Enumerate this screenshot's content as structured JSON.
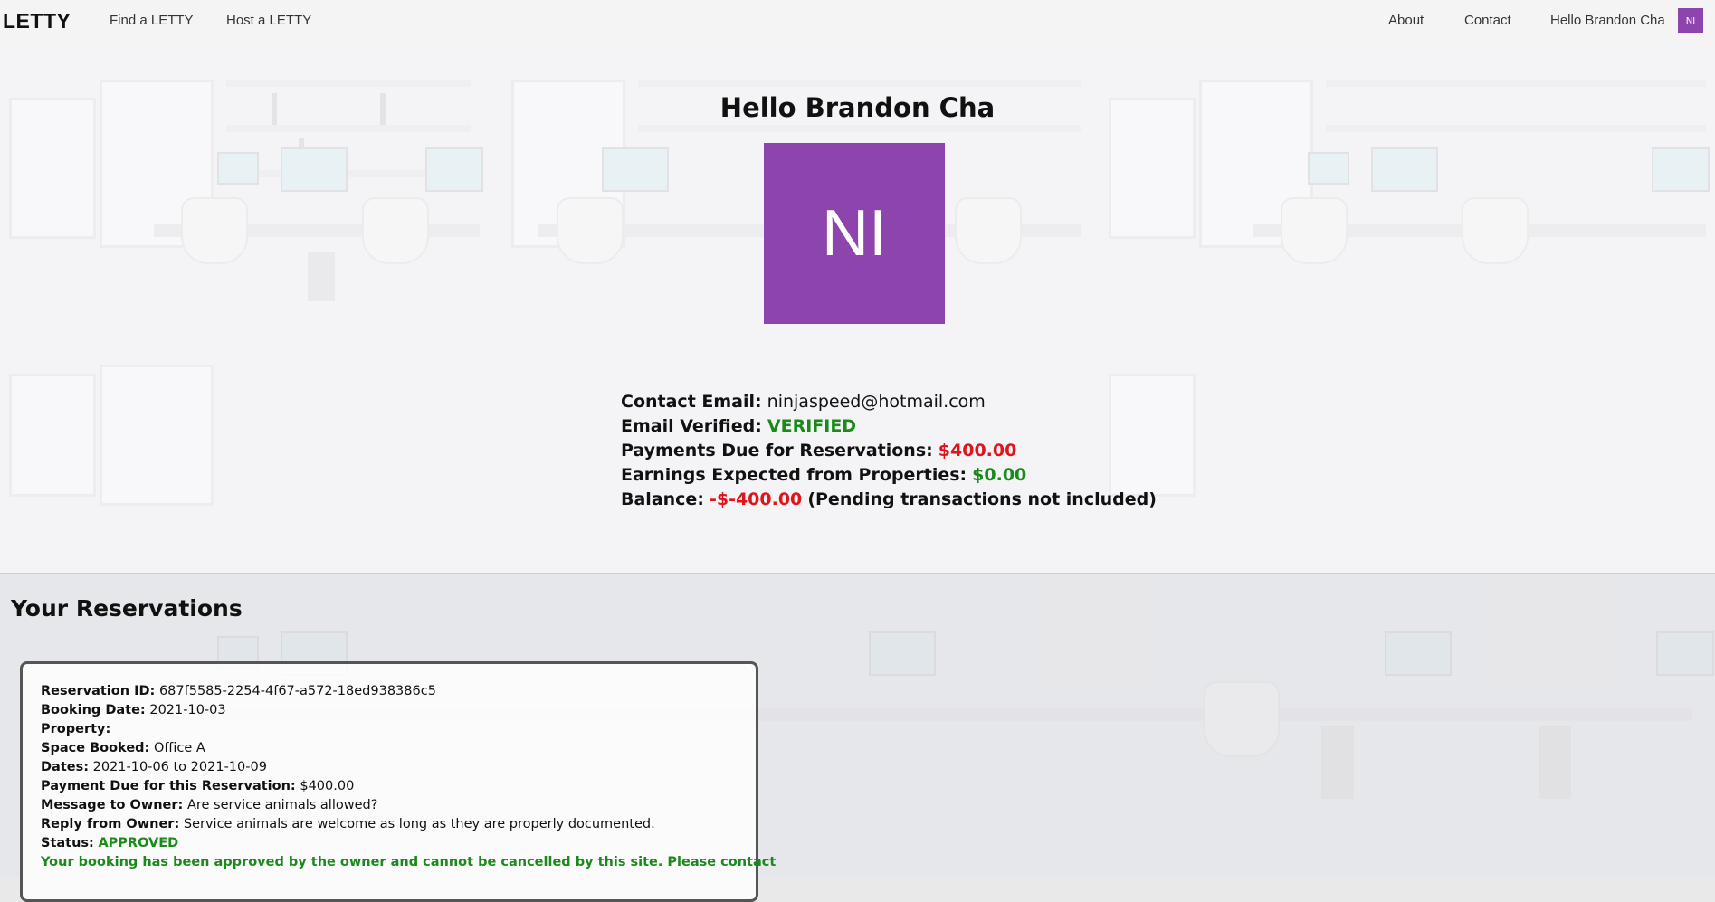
{
  "navbar": {
    "brand": "LETTY",
    "links": [
      "Find a LETTY",
      "Host a LETTY"
    ],
    "right_links": [
      "About",
      "Contact"
    ],
    "greeting": "Hello Brandon Cha",
    "avatar_initials": "NI",
    "avatar_color": "#8e44ad"
  },
  "profile": {
    "greeting": "Hello Brandon Cha",
    "avatar_initials": "NI",
    "contact_email_label": "Contact Email:",
    "contact_email": "ninjaspeed@hotmail.com",
    "email_verified_label": "Email Verified:",
    "email_verified": "VERIFIED",
    "payments_due_label": "Payments Due for Reservations:",
    "payments_due": "$400.00",
    "earnings_label": "Earnings Expected from Properties:",
    "earnings": "$0.00",
    "balance_label": "Balance:",
    "balance": "-$-400.00",
    "balance_note": "(Pending transactions not included)"
  },
  "reservations": {
    "title": "Your Reservations",
    "items": [
      {
        "id_label": "Reservation ID:",
        "id": "687f5585-2254-4f67-a572-18ed938386c5",
        "booking_date_label": "Booking Date:",
        "booking_date": "2021-10-03",
        "property_label": "Property:",
        "property": "",
        "space_label": "Space Booked:",
        "space": "Office A",
        "dates_label": "Dates:",
        "dates": "2021-10-06 to 2021-10-09",
        "payment_label": "Payment Due for this Reservation:",
        "payment": "$400.00",
        "message_label": "Message to Owner:",
        "message": "Are service animals allowed?",
        "reply_label": "Reply from Owner:",
        "reply": "Service animals are welcome as long as they are properly documented.",
        "status_label": "Status:",
        "status": "APPROVED",
        "note": "Your booking has been approved by the owner and cannot be cancelled by this site. Please contact"
      }
    ]
  },
  "colors": {
    "positive": "#1a8a1a",
    "negative": "#e0141b"
  }
}
